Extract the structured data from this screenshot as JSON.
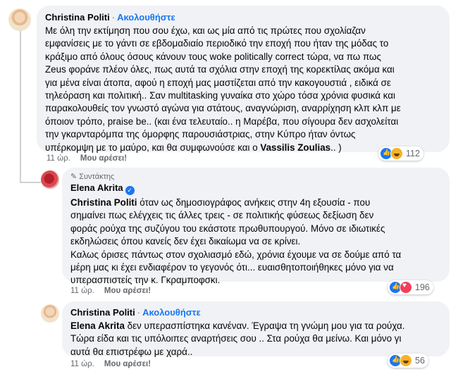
{
  "comments": [
    {
      "author": "Christina Politi",
      "separator": "·",
      "follow_label": "Ακολουθήστε",
      "lines": [
        "Με όλη την εκτίμηση που σου έχω, και ως μία από τις πρώτες που σχολίαζαν",
        "εμφανίσεις με το γάντι σε εβδομαδιαίο περιοδικό την εποχή που ήταν της μόδας το",
        "κράξιμο από όλους όσους κάνουν τους woke politically correct τώρα, να πω πως",
        "Zeus φοράνε πλέον όλες, πως αυτά τα σχόλια στην εποχή της κορεκτίλας ακόμα και",
        "για μένα είναι άτοπα, αφού η εποχή μας μαστίζεται από την κακογουστιά , ειδικά σε",
        "τηλεόραση και πολιτική.. Σαν multitasking γυναίκα στο χώρο τόσα χρόνια φυσικά και",
        "παρακολουθείς τον γνωστό αγώνα για στάτους, αναγνώριση, αναρρίχηση κλπ κλπ με",
        "όποιον τρόπο, praise be.. (και ένα τελευταίο.. η Μαρέβα, που σίγουρα δεν ασχολείται",
        "την γκαρνταρόμπα της όμορφης παρουσιάστριας, στην Κύπρο ήταν όντως",
        "υπέρκομψη με το μαύρο, και θα συμφωνούσε και ο "
      ],
      "mention": "Vassilis Zoulias",
      "tail": ".. )",
      "time": "11 ώρ.",
      "like_label": "Μου αρέσει!",
      "reaction_count": "112",
      "reaction_icons": [
        "like-icon",
        "haha-icon"
      ]
    },
    {
      "role": "Συντάκτης",
      "author": "Elena Akrita",
      "mention": "Christina Politi",
      "lines": [
        " όταν ως δημοσιογράφος ανήκεις στην 4η εξουσία - που",
        "σημαίνει πως ελέγχεις τις άλλες τρεις - σε πολιτικής φύσεως δεξίωση δεν",
        "φοράς ρούχα της συζύγου του εκάστοτε πρωθυπουργού. Μόνο σε ιδιωτικές",
        "εκδηλώσεις όπου κανείς δεν έχει δικαίωμα να σε κρίνει.",
        "Καλως όρισες πάντως στον σχολιασμό εδώ, χρόνια έχουμε να σε δούμε από τα",
        "μέρη μας κι έχει ενδιαφέρον το γεγονός ότι... ευαισθητοποιήθηκες μόνο για να",
        "υπερασπιστείς την κ. Γκραμποφσκι."
      ],
      "time": "11 ώρ.",
      "like_label": "Μου αρέσει!",
      "reaction_count": "196",
      "reaction_icons": [
        "like-icon",
        "love-icon"
      ]
    },
    {
      "author": "Christina Politi",
      "separator": "·",
      "follow_label": "Ακολουθήστε",
      "mention": "Elena Akrita",
      "lines": [
        " δεν υπερασπίστηκα κανέναν. Έγραψα τη γνώμη μου για τα ρούχα.",
        "Τώρα είδα και τις υπόλοιπες αναρτήσεις σου .. Στα ρούχα θα μείνω. Και μόνο γι",
        "αυτά θα επιστρέφω με χαρά.."
      ],
      "time": "11 ώρ.",
      "like_label": "Μου αρέσει!",
      "reaction_count": "56",
      "reaction_icons": [
        "like-icon",
        "haha-icon"
      ]
    }
  ]
}
